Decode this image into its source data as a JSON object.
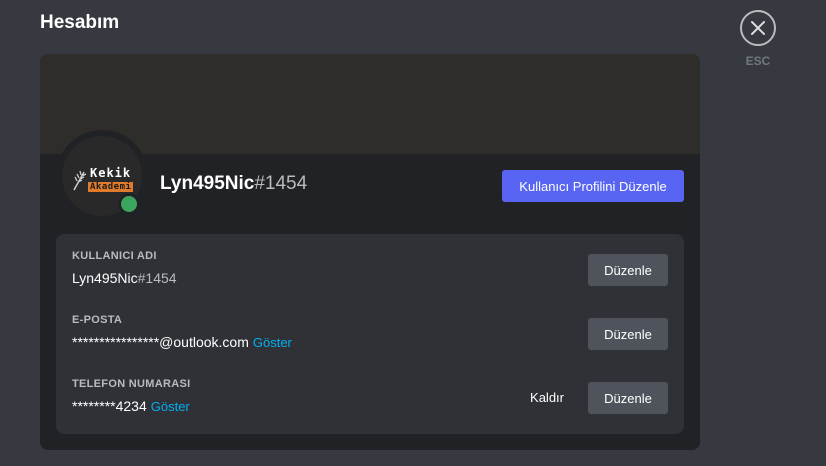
{
  "page": {
    "title": "Hesabım"
  },
  "close": {
    "icon": "close-icon",
    "esc_label": "ESC"
  },
  "profile": {
    "username": "Lyn495Nic",
    "discriminator": "#1454",
    "avatar_logo_top": "Kekik",
    "avatar_logo_bottom": "Akademi",
    "status": "online",
    "status_color": "#3ba55d",
    "edit_profile_label": "Kullanıcı Profilini Düzenle"
  },
  "fields": {
    "username": {
      "label": "KULLANICI ADI",
      "value_name": "Lyn495Nic",
      "value_disc": "#1454",
      "edit_label": "Düzenle"
    },
    "email": {
      "label": "E-POSTA",
      "value": "****************@outlook.com",
      "show_label": "Göster",
      "edit_label": "Düzenle"
    },
    "phone": {
      "label": "TELEFON NUMARASI",
      "value": "********4234",
      "show_label": "Göster",
      "remove_label": "Kaldır",
      "edit_label": "Düzenle"
    }
  },
  "colors": {
    "background": "#36393f",
    "card": "#202225",
    "accent": "#5865f2",
    "link": "#00aff4",
    "secondary_button": "#4f545c"
  }
}
